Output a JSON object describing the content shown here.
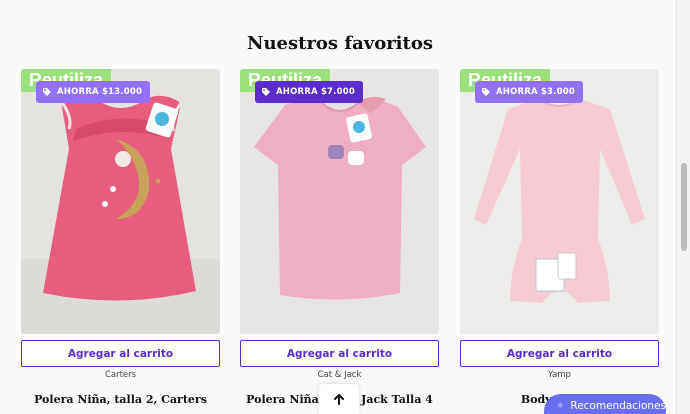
{
  "section": {
    "title": "Nuestros favoritos"
  },
  "products": [
    {
      "corner_label": "Reutiliza",
      "badge": "AHORRA $13.000",
      "cart_label": "Agregar al carrito",
      "vendor": "Carters",
      "title": "Polera Niña, talla 2, Carters",
      "garment_color": "#e75d7d"
    },
    {
      "corner_label": "Reutiliza",
      "badge": "AHORRA $7.000",
      "cart_label": "Agregar al carrito",
      "vendor": "Cat & Jack",
      "title": "Polera Niña Cat & Jack Talla 4",
      "garment_color": "#efaec2"
    },
    {
      "corner_label": "Reutiliza",
      "badge": "AHORRA $3.000",
      "cart_label": "Agregar al carrito",
      "vendor": "Yamp",
      "title": "Body niña, 9",
      "garment_color": "#f6ccd4"
    }
  ],
  "floating": {
    "recommend_label": "Recomendaciones"
  },
  "colors": {
    "accent": "#5b2ccc",
    "corner_tag": "#9be07a",
    "floating_button": "#6a6df0"
  }
}
